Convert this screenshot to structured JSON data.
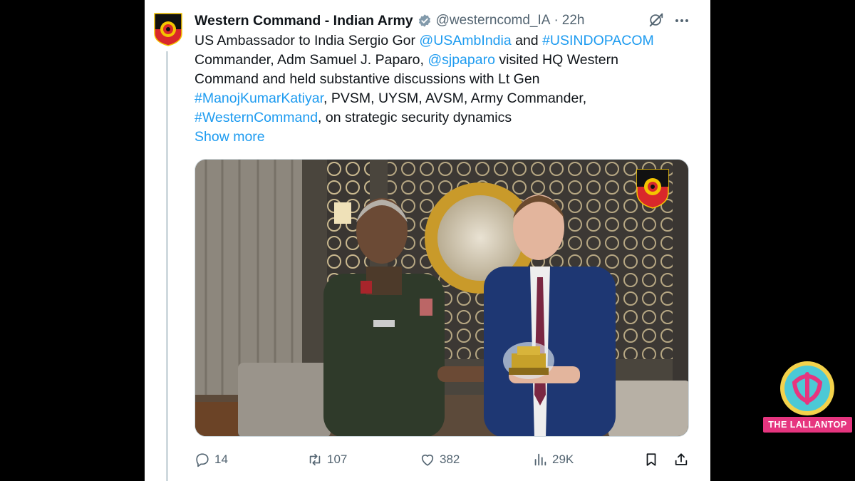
{
  "tweet": {
    "author_name": "Western Command - Indian Army",
    "handle": "@westerncomd_IA",
    "separator": "·",
    "time": "22h",
    "lines": [
      [
        {
          "text": "US Ambassador to India Sergio Gor ",
          "link": false
        },
        {
          "text": "@USAmbIndia",
          "link": true
        },
        {
          "text": " and ",
          "link": false
        },
        {
          "text": "#USINDOPACOM",
          "link": true
        }
      ],
      [
        {
          "text": "Commander, Adm Samuel J. Paparo, ",
          "link": false
        },
        {
          "text": "@sjpaparo",
          "link": true
        },
        {
          "text": " visited HQ Western",
          "link": false
        }
      ],
      [
        {
          "text": "Command and held substantive discussions with Lt Gen",
          "link": false
        }
      ],
      [
        {
          "text": "#ManojKumarKatiyar",
          "link": true
        },
        {
          "text": ", PVSM, UYSM, AVSM, Army Commander,",
          "link": false
        }
      ],
      [
        {
          "text": "#WesternCommand",
          "link": true
        },
        {
          "text": ", on strategic security dynamics",
          "link": false
        }
      ]
    ],
    "show_more": "Show more"
  },
  "media": {
    "description_icon": "photo-of-two-men-exchanging-memento"
  },
  "actions": {
    "replies": "14",
    "reposts": "107",
    "likes": "382",
    "views": "29K"
  },
  "icons": {
    "verified": "verified-badge-icon",
    "grok": "grok-icon",
    "more": "more-icon",
    "reply": "reply-icon",
    "repost": "repost-icon",
    "like": "like-icon",
    "views": "views-icon",
    "bookmark": "bookmark-icon",
    "share": "share-icon"
  },
  "colors": {
    "link": "#1d9bf0",
    "text": "#0f1419",
    "secondary": "#536471",
    "brand_pink": "#e6357f"
  },
  "brand": {
    "label": "THE LALLANTOP"
  }
}
